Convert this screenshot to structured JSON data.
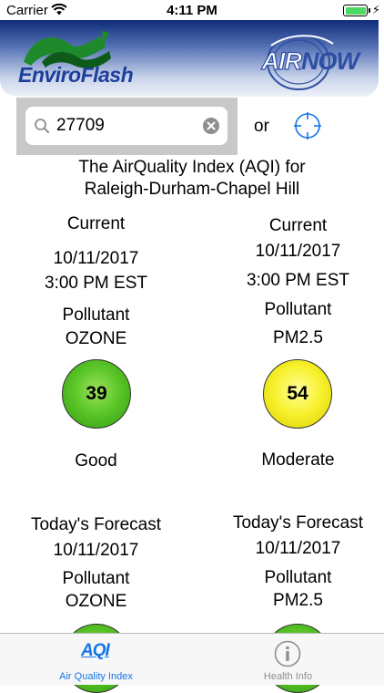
{
  "status_bar": {
    "carrier": "Carrier",
    "time": "4:11 PM"
  },
  "header": {
    "enviroflash_logo_text": "EnviroFlash",
    "airnow_logo_air": "AIR",
    "airnow_logo_now": "NOW"
  },
  "search": {
    "value": "27709",
    "or_label": "or"
  },
  "heading": {
    "line1": "The AirQuality Index (AQI) for",
    "line2": "Raleigh-Durham-Chapel Hill"
  },
  "current": [
    {
      "label": "Current",
      "date": "10/11/2017",
      "time": "3:00 PM EST",
      "pollutant_label": "Pollutant",
      "pollutant": "OZONE",
      "aqi": "39",
      "category": "Good",
      "color": "#5cc728"
    },
    {
      "label": "Current",
      "date": "10/11/2017",
      "time": "3:00 PM EST",
      "pollutant_label": "Pollutant",
      "pollutant": "PM2.5",
      "aqi": "54",
      "category": "Moderate",
      "color": "#f7f02a"
    }
  ],
  "forecast": [
    {
      "label": "Today's Forecast",
      "date": "10/11/2017",
      "pollutant_label": "Pollutant",
      "pollutant": "OZONE",
      "color": "#5cc728"
    },
    {
      "label": "Today's Forecast",
      "date": "10/11/2017",
      "pollutant_label": "Pollutant",
      "pollutant": "PM2.5",
      "color": "#5cc728"
    }
  ],
  "tabs": [
    {
      "label": "Air Quality Index",
      "icon_text": "AQI",
      "icon": "aqi-icon",
      "active": true
    },
    {
      "label": "Health Info",
      "icon": "info-icon",
      "active": false
    }
  ],
  "colors": {
    "accent": "#1475e8",
    "good": "#5cc728",
    "moderate": "#f7f02a"
  }
}
